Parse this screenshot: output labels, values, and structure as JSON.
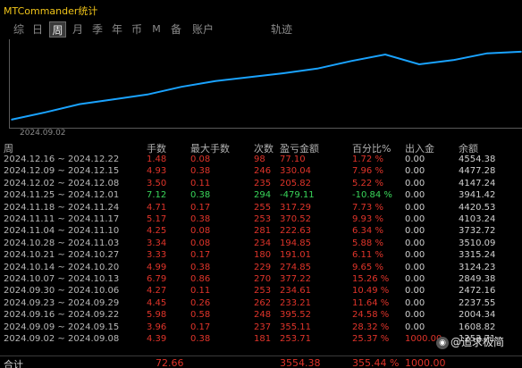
{
  "app": {
    "title": "MTCommander统计"
  },
  "tabs": [
    {
      "label": "综",
      "active": false
    },
    {
      "label": "日",
      "active": false
    },
    {
      "label": "周",
      "active": true
    },
    {
      "label": "月",
      "active": false
    },
    {
      "label": "季",
      "active": false
    },
    {
      "label": "年",
      "active": false
    },
    {
      "label": "币",
      "active": false
    },
    {
      "label": "M",
      "active": false
    },
    {
      "label": "备",
      "active": false
    },
    {
      "label": "账户",
      "active": false
    },
    {
      "label": "轨迹",
      "active": false
    }
  ],
  "chart_data": {
    "type": "line",
    "x": [
      "2024.09.02",
      "2024.09.09",
      "2024.09.16",
      "2024.09.23",
      "2024.09.30",
      "2024.10.07",
      "2024.10.14",
      "2024.10.21",
      "2024.10.28",
      "2024.11.04",
      "2024.11.11",
      "2024.11.18",
      "2024.11.25",
      "2024.12.02",
      "2024.12.09",
      "2024.12.16"
    ],
    "y": [
      1253.71,
      1608.82,
      2004.34,
      2237.55,
      2472.16,
      2849.38,
      3124.23,
      3315.24,
      3510.09,
      3732.72,
      4103.24,
      4420.53,
      3941.42,
      4147.24,
      4477.28,
      4554.38
    ],
    "x_tick_label": "2024.09.02",
    "line_color": "#1aa3ff",
    "grid": false
  },
  "table": {
    "headers": [
      "周",
      "手数",
      "最大手数",
      "次数",
      "盈亏金额",
      "百分比%",
      "出入金",
      "余额"
    ],
    "rows": [
      {
        "period": "2024.12.16 ~ 2024.12.22",
        "lots": "1.48",
        "max_lots": "0.08",
        "count": "98",
        "pnl": "77.10",
        "pct": "1.72 %",
        "flow": "0.00",
        "balance": "4554.38",
        "sign": "pos"
      },
      {
        "period": "2024.12.09 ~ 2024.12.15",
        "lots": "4.93",
        "max_lots": "0.38",
        "count": "246",
        "pnl": "330.04",
        "pct": "7.96 %",
        "flow": "0.00",
        "balance": "4477.28",
        "sign": "pos"
      },
      {
        "period": "2024.12.02 ~ 2024.12.08",
        "lots": "3.50",
        "max_lots": "0.11",
        "count": "235",
        "pnl": "205.82",
        "pct": "5.22 %",
        "flow": "0.00",
        "balance": "4147.24",
        "sign": "pos"
      },
      {
        "period": "2024.11.25 ~ 2024.12.01",
        "lots": "7.12",
        "max_lots": "0.38",
        "count": "294",
        "pnl": "-479.11",
        "pct": "-10.84 %",
        "flow": "0.00",
        "balance": "3941.42",
        "sign": "neg"
      },
      {
        "period": "2024.11.18 ~ 2024.11.24",
        "lots": "4.71",
        "max_lots": "0.17",
        "count": "255",
        "pnl": "317.29",
        "pct": "7.73 %",
        "flow": "0.00",
        "balance": "4420.53",
        "sign": "pos"
      },
      {
        "period": "2024.11.11 ~ 2024.11.17",
        "lots": "5.17",
        "max_lots": "0.38",
        "count": "253",
        "pnl": "370.52",
        "pct": "9.93 %",
        "flow": "0.00",
        "balance": "4103.24",
        "sign": "pos"
      },
      {
        "period": "2024.11.04 ~ 2024.11.10",
        "lots": "4.25",
        "max_lots": "0.08",
        "count": "281",
        "pnl": "222.63",
        "pct": "6.34 %",
        "flow": "0.00",
        "balance": "3732.72",
        "sign": "pos"
      },
      {
        "period": "2024.10.28 ~ 2024.11.03",
        "lots": "3.34",
        "max_lots": "0.08",
        "count": "234",
        "pnl": "194.85",
        "pct": "5.88 %",
        "flow": "0.00",
        "balance": "3510.09",
        "sign": "pos"
      },
      {
        "period": "2024.10.21 ~ 2024.10.27",
        "lots": "3.33",
        "max_lots": "0.17",
        "count": "180",
        "pnl": "191.01",
        "pct": "6.11 %",
        "flow": "0.00",
        "balance": "3315.24",
        "sign": "pos"
      },
      {
        "period": "2024.10.14 ~ 2024.10.20",
        "lots": "4.99",
        "max_lots": "0.38",
        "count": "229",
        "pnl": "274.85",
        "pct": "9.65 %",
        "flow": "0.00",
        "balance": "3124.23",
        "sign": "pos"
      },
      {
        "period": "2024.10.07 ~ 2024.10.13",
        "lots": "6.79",
        "max_lots": "0.86",
        "count": "270",
        "pnl": "377.22",
        "pct": "15.26 %",
        "flow": "0.00",
        "balance": "2849.38",
        "sign": "pos"
      },
      {
        "period": "2024.09.30 ~ 2024.10.06",
        "lots": "4.27",
        "max_lots": "0.11",
        "count": "253",
        "pnl": "234.61",
        "pct": "10.49 %",
        "flow": "0.00",
        "balance": "2472.16",
        "sign": "pos"
      },
      {
        "period": "2024.09.23 ~ 2024.09.29",
        "lots": "4.45",
        "max_lots": "0.26",
        "count": "262",
        "pnl": "233.21",
        "pct": "11.64 %",
        "flow": "0.00",
        "balance": "2237.55",
        "sign": "pos"
      },
      {
        "period": "2024.09.16 ~ 2024.09.22",
        "lots": "5.98",
        "max_lots": "0.58",
        "count": "248",
        "pnl": "395.52",
        "pct": "24.58 %",
        "flow": "0.00",
        "balance": "2004.34",
        "sign": "pos"
      },
      {
        "period": "2024.09.09 ~ 2024.09.15",
        "lots": "3.96",
        "max_lots": "0.17",
        "count": "237",
        "pnl": "355.11",
        "pct": "28.32 %",
        "flow": "0.00",
        "balance": "1608.82",
        "sign": "pos"
      },
      {
        "period": "2024.09.02 ~ 2024.09.08",
        "lots": "4.39",
        "max_lots": "0.38",
        "count": "181",
        "pnl": "253.71",
        "pct": "25.37 %",
        "flow": "1000.00",
        "balance": "1253.71",
        "sign": "pos"
      }
    ],
    "total": {
      "label": "合计",
      "lots": "72.66",
      "pnl": "3554.38",
      "pct": "355.44 %",
      "flow": "1000.00"
    }
  },
  "watermark": {
    "text": "@追求极简"
  },
  "colors": {
    "positive": "#e0342a",
    "negative": "#39d65a",
    "title": "#f0c419",
    "line": "#1aa3ff"
  }
}
